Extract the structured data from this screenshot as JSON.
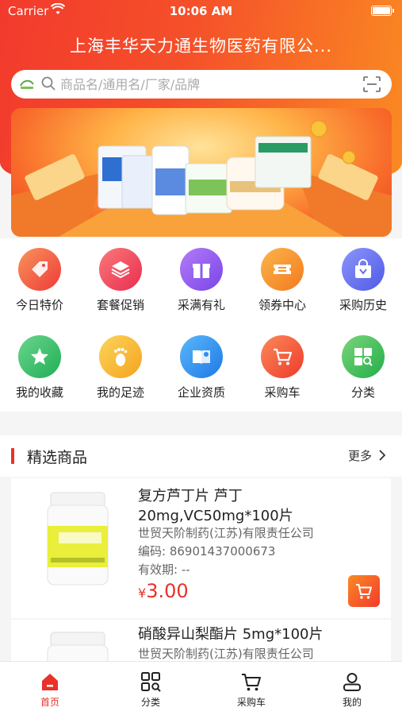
{
  "status_bar": {
    "carrier": "Carrier",
    "time": "10:06 AM"
  },
  "header": {
    "store_title": "上海丰华天力通生物医药有限公..."
  },
  "search": {
    "placeholder": "商品名/通用名/厂家/品牌"
  },
  "categories": [
    {
      "label": "今日特价",
      "icon": "price-tag-icon",
      "color": "#f0553b"
    },
    {
      "label": "套餐促销",
      "icon": "layers-icon",
      "color": "#f2454f"
    },
    {
      "label": "采满有礼",
      "icon": "gift-icon",
      "color": "#8a5cf0"
    },
    {
      "label": "领券中心",
      "icon": "coupon-icon",
      "color": "#f7962b"
    },
    {
      "label": "采购历史",
      "icon": "shopping-bag-icon",
      "color": "#6470f0"
    },
    {
      "label": "我的收藏",
      "icon": "star-icon",
      "color": "#2fbf6a"
    },
    {
      "label": "我的足迹",
      "icon": "footprint-icon",
      "color": "#f7b52b"
    },
    {
      "label": "企业资质",
      "icon": "certificate-book-icon",
      "color": "#2b8ff0"
    },
    {
      "label": "采购车",
      "icon": "cart-icon",
      "color": "#f25a3b"
    },
    {
      "label": "分类",
      "icon": "category-grid-icon",
      "color": "#3cc25a"
    }
  ],
  "featured": {
    "title": "精选商品",
    "more_label": "更多"
  },
  "products": [
    {
      "name": "复方芦丁片 芦丁20mg,VC50mg*100片",
      "manufacturer": "世贸天阶制药(江苏)有限责任公司",
      "code_label": "编码:",
      "code": "86901437000673",
      "expiry_label": "有效期:",
      "expiry": "--",
      "currency": "¥",
      "price": "3.00"
    },
    {
      "name": "硝酸异山梨酯片 5mg*100片",
      "manufacturer": "世贸天阶制药(江苏)有限责任公司"
    }
  ],
  "tab_bar": [
    {
      "label": "首页",
      "icon": "home-icon",
      "active": true
    },
    {
      "label": "分类",
      "icon": "category-icon",
      "active": false
    },
    {
      "label": "采购车",
      "icon": "cart-icon",
      "active": false
    },
    {
      "label": "我的",
      "icon": "profile-icon",
      "active": false
    }
  ],
  "colors": {
    "accent": "#e8322a",
    "header_start": "#f23a2c",
    "header_end": "#fa8a22"
  }
}
